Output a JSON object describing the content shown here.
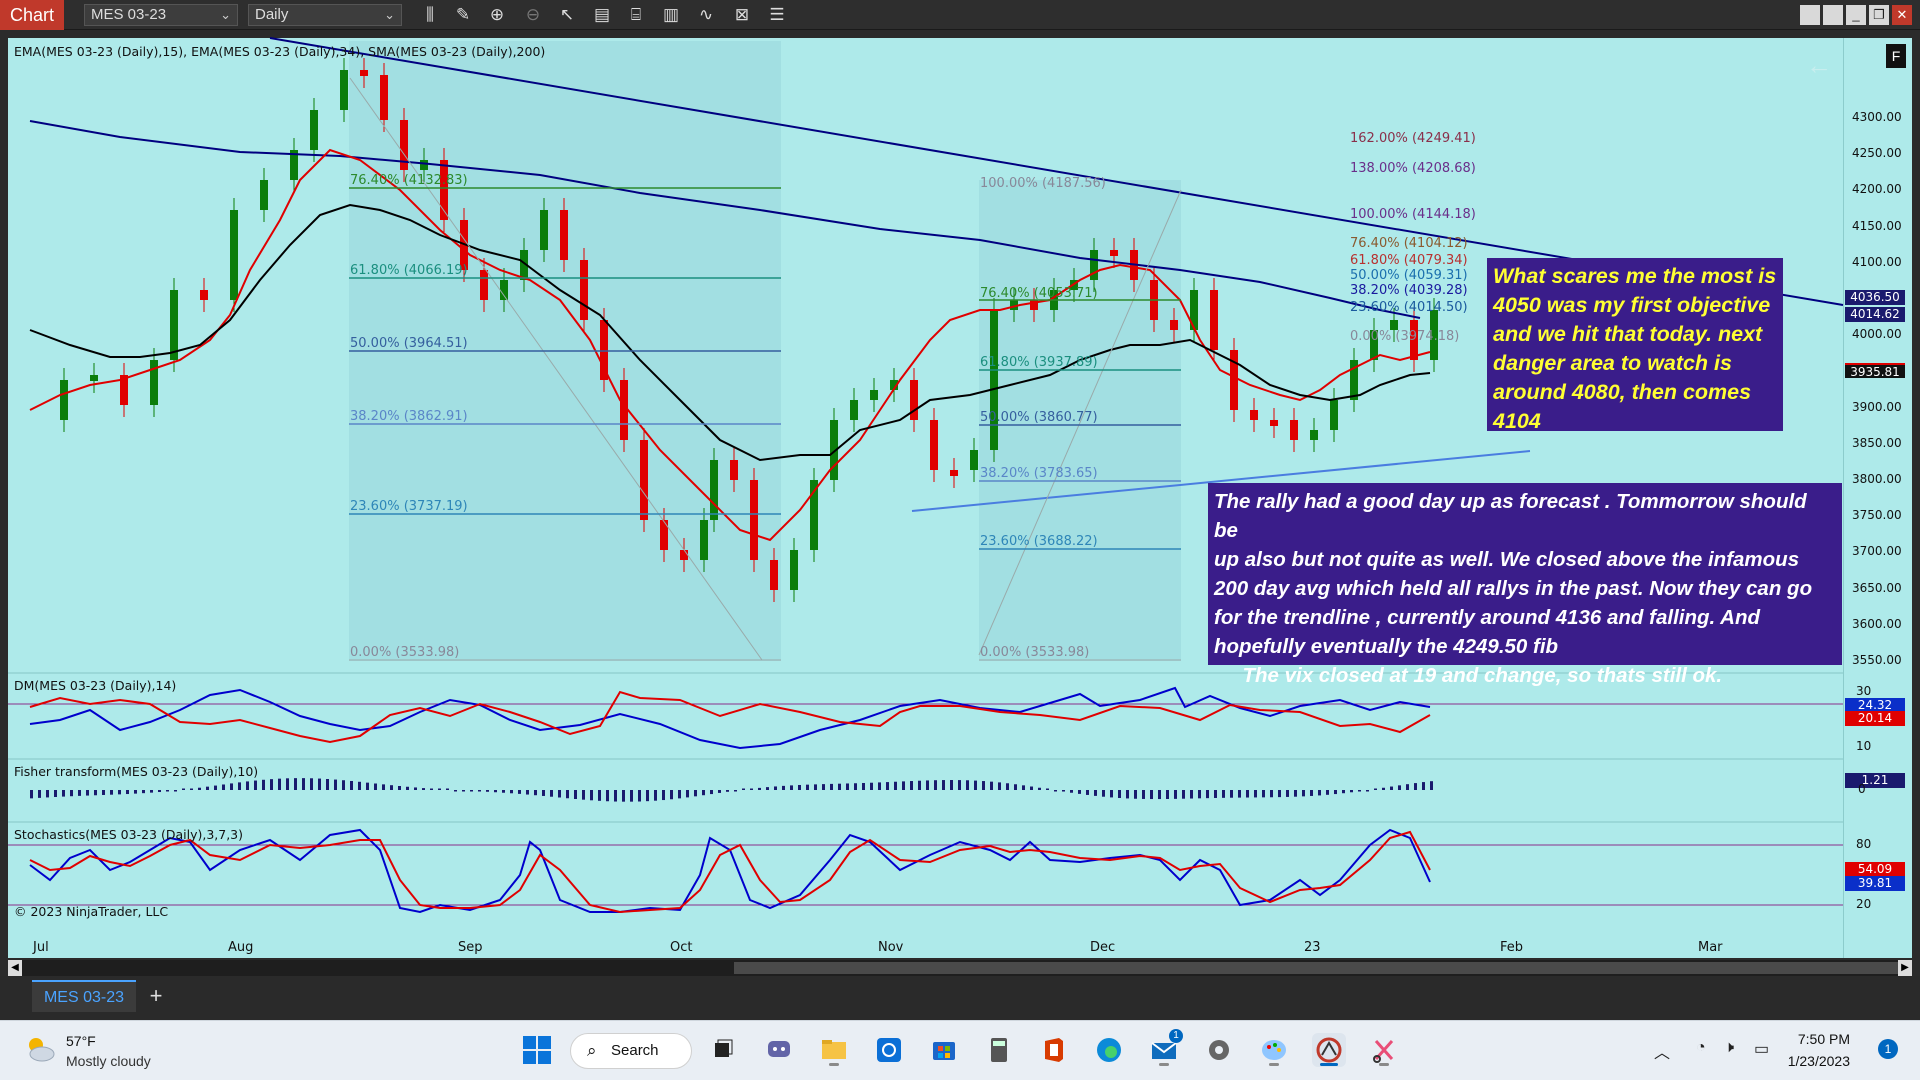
{
  "titlebar": {
    "chart_label": "Chart",
    "instrument": "MES 03-23",
    "period": "Daily",
    "toolbar_icons": [
      "bar-type-icon",
      "draw-tool-icon",
      "zoom-in-icon",
      "zoom-out-icon",
      "pointer-icon",
      "data-box-icon",
      "chart-style-icon",
      "properties-icon",
      "indicators-icon",
      "strategies-icon",
      "menu-icon"
    ]
  },
  "chart": {
    "price_indicators_label": "EMA(MES 03-23 (Daily),15), EMA(MES 03-23 (Daily),34), SMA(MES 03-23 (Daily),200)",
    "dm_label": "DM(MES 03-23 (Daily),14)",
    "fisher_label": "Fisher transform(MES 03-23 (Daily),10)",
    "stoch_label": "Stochastics(MES 03-23 (Daily),3,7,3)",
    "copyright": "© 2023 NinjaTrader, LLC",
    "price_ticks": [
      "4300.00",
      "4250.00",
      "4200.00",
      "4150.00",
      "4100.00",
      "4050.00",
      "4000.00",
      "3950.00",
      "3900.00",
      "3850.00",
      "3800.00",
      "3750.00",
      "3700.00",
      "3650.00",
      "3600.00",
      "3550.00"
    ],
    "price_boxes": {
      "sma200": "4036.50",
      "ema34": "4014.62",
      "last": "3935.81"
    },
    "dm_ticks": [
      "30",
      "10"
    ],
    "dm_boxes": {
      "plus": "24.32",
      "minus": "20.14"
    },
    "fisher_box": "1.21",
    "fisher_tick": "0",
    "stoch_ticks": [
      "80",
      "20"
    ],
    "stoch_boxes": {
      "k": "54.09",
      "d": "39.81"
    },
    "months": [
      "Jul",
      "Aug",
      "Sep",
      "Oct",
      "Nov",
      "Dec",
      "23",
      "Feb",
      "Mar"
    ],
    "fib1": [
      "76.40% (4132.83)",
      "61.80% (4066.19)",
      "50.00% (3964.51)",
      "38.20% (3862.91)",
      "23.60% (3737.19)",
      "0.00% (3533.98)"
    ],
    "fib2": [
      "100.00% (4187.56)",
      "76.40% (4053.71)",
      "61.80% (3937.89)",
      "50.00% (3860.77)",
      "38.20% (3783.65)",
      "23.60% (3688.22)",
      "0.00% (3533.98)"
    ],
    "fib3": [
      "162.00% (4249.41)",
      "138.00% (4208.68)",
      "100.00% (4144.18)",
      "76.40% (4104.12)",
      "61.80% (4079.34)",
      "50.00% (4059.31)",
      "38.20% (4039.28)",
      "23.60% (4014.50)",
      "0.00% (3974.18)"
    ],
    "colors": {
      "bg": "#aeeaea",
      "up": "#0b7d0b",
      "down": "#e00000",
      "sma": "#000080",
      "ema15": "#e00000",
      "ema34": "#000000",
      "note_bg": "#3a1d8a",
      "note_yellow": "#ffff33"
    }
  },
  "notes": {
    "note1": [
      "What scares me the most is",
      "4050 was my first objective",
      "and we hit that today. next",
      "danger area to watch is",
      "around 4080, then comes",
      "4104"
    ],
    "note2": [
      "The rally had a good day up as forecast . Tommorrow should be",
      "up also but not quite as well. We closed above the infamous",
      "200 day avg which held all rallys in the past. Now they can go",
      "for the trendline , currently around 4136 and falling. And",
      "hopefully eventually the 4249.50 fib",
      "     The vix closed at 19 and change, so thats still ok."
    ]
  },
  "tabs": {
    "instrument_tab": "MES 03-23",
    "add_tab": "+"
  },
  "taskbar": {
    "temp": "57°F",
    "weather": "Mostly cloudy",
    "search": "Search",
    "time": "7:50 PM",
    "date": "1/23/2023",
    "notification_count": "1",
    "mail_badge": "1"
  }
}
